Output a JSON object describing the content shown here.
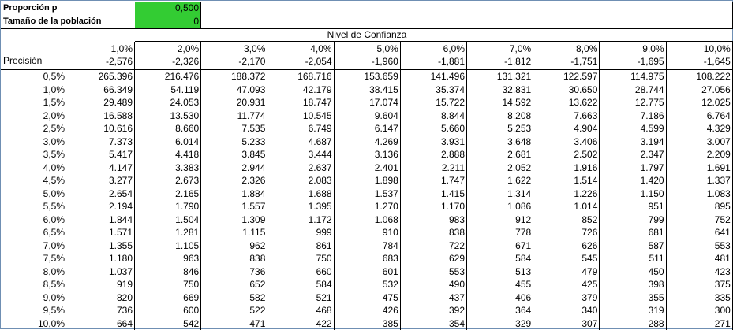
{
  "params": {
    "proporcion_label": "Proporción p",
    "proporcion_value": "0,500",
    "poblacion_label": "Tamaño de la población",
    "poblacion_value": "0"
  },
  "nivel_title": "Nivel de Confianza",
  "precision_label": "Precisión",
  "confidences": [
    "1,0%",
    "2,0%",
    "3,0%",
    "4,0%",
    "5,0%",
    "6,0%",
    "7,0%",
    "8,0%",
    "9,0%",
    "10,0%"
  ],
  "z_values": [
    "-2,576",
    "-2,326",
    "-2,170",
    "-2,054",
    "-1,960",
    "-1,881",
    "-1,812",
    "-1,751",
    "-1,695",
    "-1,645"
  ],
  "rows": [
    {
      "precision": "0,5%",
      "values": [
        "265.396",
        "216.476",
        "188.372",
        "168.716",
        "153.659",
        "141.496",
        "131.321",
        "122.597",
        "114.975",
        "108.222"
      ]
    },
    {
      "precision": "1,0%",
      "values": [
        "66.349",
        "54.119",
        "47.093",
        "42.179",
        "38.415",
        "35.374",
        "32.831",
        "30.650",
        "28.744",
        "27.056"
      ]
    },
    {
      "precision": "1,5%",
      "values": [
        "29.489",
        "24.053",
        "20.931",
        "18.747",
        "17.074",
        "15.722",
        "14.592",
        "13.622",
        "12.775",
        "12.025"
      ]
    },
    {
      "precision": "2,0%",
      "values": [
        "16.588",
        "13.530",
        "11.774",
        "10.545",
        "9.604",
        "8.844",
        "8.208",
        "7.663",
        "7.186",
        "6.764"
      ]
    },
    {
      "precision": "2,5%",
      "values": [
        "10.616",
        "8.660",
        "7.535",
        "6.749",
        "6.147",
        "5.660",
        "5.253",
        "4.904",
        "4.599",
        "4.329"
      ]
    },
    {
      "precision": "3,0%",
      "values": [
        "7.373",
        "6.014",
        "5.233",
        "4.687",
        "4.269",
        "3.931",
        "3.648",
        "3.406",
        "3.194",
        "3.007"
      ]
    },
    {
      "precision": "3,5%",
      "values": [
        "5.417",
        "4.418",
        "3.845",
        "3.444",
        "3.136",
        "2.888",
        "2.681",
        "2.502",
        "2.347",
        "2.209"
      ]
    },
    {
      "precision": "4,0%",
      "values": [
        "4.147",
        "3.383",
        "2.944",
        "2.637",
        "2.401",
        "2.211",
        "2.052",
        "1.916",
        "1.797",
        "1.691"
      ]
    },
    {
      "precision": "4,5%",
      "values": [
        "3.277",
        "2.673",
        "2.326",
        "2.083",
        "1.898",
        "1.747",
        "1.622",
        "1.514",
        "1.420",
        "1.337"
      ]
    },
    {
      "precision": "5,0%",
      "values": [
        "2.654",
        "2.165",
        "1.884",
        "1.688",
        "1.537",
        "1.415",
        "1.314",
        "1.226",
        "1.150",
        "1.083"
      ]
    },
    {
      "precision": "5,5%",
      "values": [
        "2.194",
        "1.790",
        "1.557",
        "1.395",
        "1.270",
        "1.170",
        "1.086",
        "1.014",
        "951",
        "895"
      ]
    },
    {
      "precision": "6,0%",
      "values": [
        "1.844",
        "1.504",
        "1.309",
        "1.172",
        "1.068",
        "983",
        "912",
        "852",
        "799",
        "752"
      ]
    },
    {
      "precision": "6,5%",
      "values": [
        "1.571",
        "1.281",
        "1.115",
        "999",
        "910",
        "838",
        "778",
        "726",
        "681",
        "641"
      ]
    },
    {
      "precision": "7,0%",
      "values": [
        "1.355",
        "1.105",
        "962",
        "861",
        "784",
        "722",
        "671",
        "626",
        "587",
        "553"
      ]
    },
    {
      "precision": "7,5%",
      "values": [
        "1.180",
        "963",
        "838",
        "750",
        "683",
        "629",
        "584",
        "545",
        "511",
        "481"
      ]
    },
    {
      "precision": "8,0%",
      "values": [
        "1.037",
        "846",
        "736",
        "660",
        "601",
        "553",
        "513",
        "479",
        "450",
        "423"
      ]
    },
    {
      "precision": "8,5%",
      "values": [
        "919",
        "750",
        "652",
        "584",
        "532",
        "490",
        "455",
        "425",
        "398",
        "375"
      ]
    },
    {
      "precision": "9,0%",
      "values": [
        "820",
        "669",
        "582",
        "521",
        "475",
        "437",
        "406",
        "379",
        "355",
        "335"
      ]
    },
    {
      "precision": "9,5%",
      "values": [
        "736",
        "600",
        "522",
        "468",
        "426",
        "392",
        "364",
        "340",
        "319",
        "300"
      ]
    },
    {
      "precision": "10,0%",
      "values": [
        "664",
        "542",
        "471",
        "422",
        "385",
        "354",
        "329",
        "307",
        "288",
        "271"
      ]
    }
  ]
}
